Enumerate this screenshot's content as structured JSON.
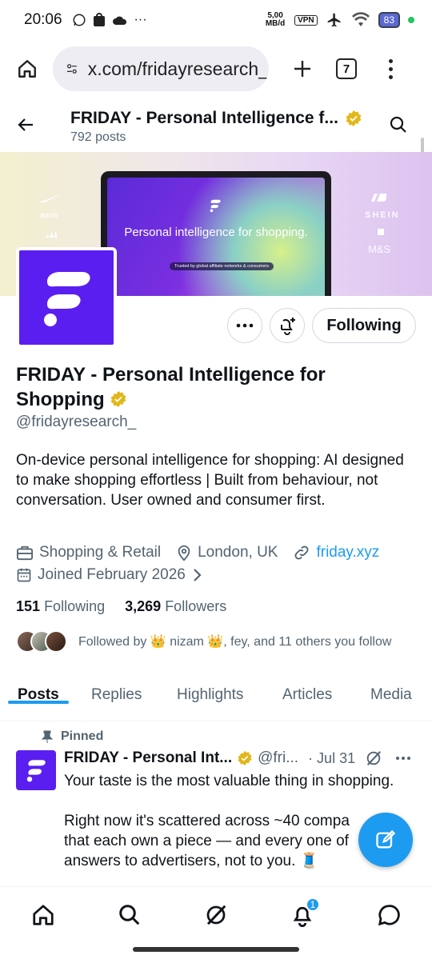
{
  "status": {
    "time": "20:06",
    "speed": "5,00 MB/d",
    "vpn": "VPN",
    "battery": "83"
  },
  "browser": {
    "url": "x.com/fridayresearch_",
    "tab_count": "7"
  },
  "header": {
    "title": "FRIDAY - Personal Intelligence f...",
    "posts": "792 posts"
  },
  "banner": {
    "headline": "Personal intelligence for shopping.",
    "trusted": "Trusted by global affiliate networks & consumers",
    "brands_left": [
      "asos"
    ],
    "brands_right": [
      "SHEIN",
      "M&S"
    ]
  },
  "profile": {
    "name": "FRIDAY - Personal Intelligence for Shopping",
    "handle": "@fridayresearch_",
    "bio": "On-device personal intelligence for shopping: AI designed to make shopping effortless | Built from behaviour, not conversation. User owned and consumer first.",
    "category": "Shopping & Retail",
    "location": "London, UK",
    "website": "friday.xyz",
    "joined": "Joined February 2026",
    "following_count": "151",
    "following_label": "Following",
    "followers_count": "3,269",
    "followers_label": "Followers",
    "followed_by": "Followed by 👑 nizam 👑, fey, and 11 others you follow",
    "follow_button": "Following"
  },
  "tabs": [
    "Posts",
    "Replies",
    "Highlights",
    "Articles",
    "Media"
  ],
  "tweet": {
    "pinned_label": "Pinned",
    "author": "FRIDAY - Personal Int...",
    "handle": "@fri...",
    "date": "· Jul 31",
    "line1": "Your taste is the most valuable thing in shopping.",
    "line2": "Right now it's scattered across ~40 compa",
    "line3": "that each own a piece — and every one of",
    "line4": "answers to advertisers, not to you. 🧵"
  },
  "nav": {
    "notifications_badge": "1"
  },
  "colors": {
    "accent": "#1d9bf0",
    "brand": "#5b1ef0",
    "verified": "#e2b719"
  }
}
